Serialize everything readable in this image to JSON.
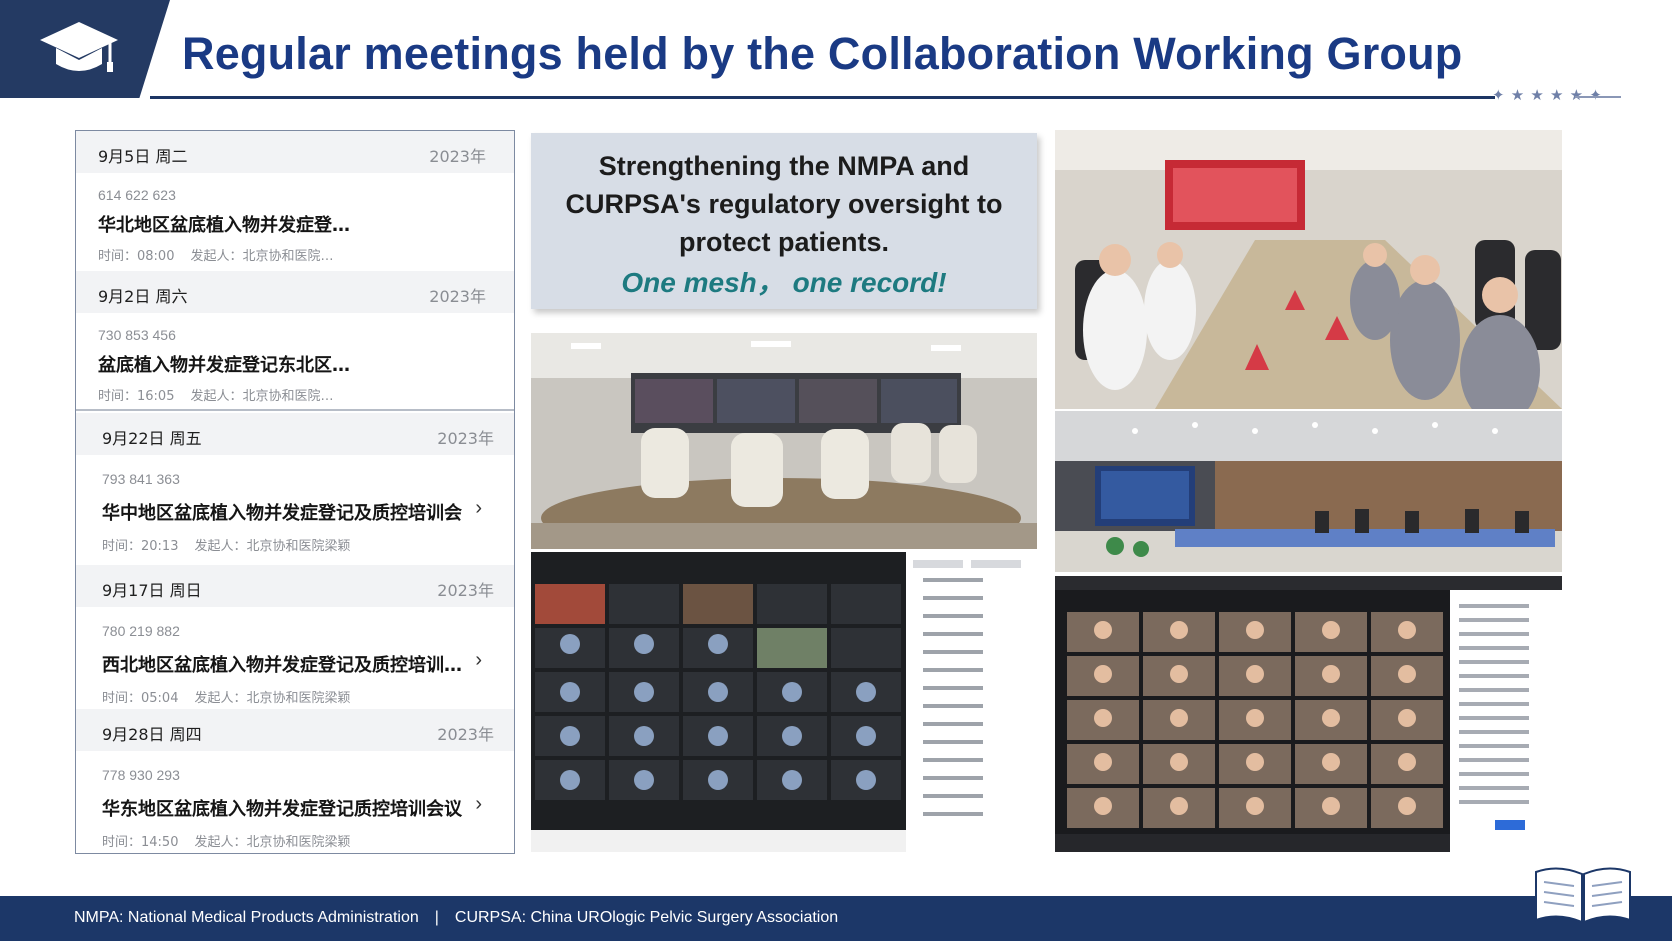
{
  "header": {
    "title": "Regular meetings held by the Collaboration Working Group"
  },
  "calendar": {
    "sections": [
      {
        "date": "9月5日 周二",
        "year": "2023年",
        "meeting_id": "614 622 623",
        "name": "华北地区盆底植入物并发症登…",
        "time": "时间：08:00",
        "organizer": "发起人：北京协和医院…",
        "has_arrow": false
      },
      {
        "date": "9月2日 周六",
        "year": "2023年",
        "meeting_id": "730 853 456",
        "name": "盆底植入物并发症登记东北区…",
        "time": "时间：16:05",
        "organizer": "发起人：北京协和医院…",
        "has_arrow": false
      },
      {
        "date": "9月22日 周五",
        "year": "2023年",
        "meeting_id": "793 841 363",
        "name": "华中地区盆底植入物并发症登记及质控培训会",
        "time": "时间：20:13",
        "organizer": "发起人：北京协和医院梁颖",
        "has_arrow": true
      },
      {
        "date": "9月17日 周日",
        "year": "2023年",
        "meeting_id": "780 219 882",
        "name": "西北地区盆底植入物并发症登记及质控培训…",
        "time": "时间：05:04",
        "organizer": "发起人：北京协和医院梁颖",
        "has_arrow": true
      },
      {
        "date": "9月28日 周四",
        "year": "2023年",
        "meeting_id": "778 930 293",
        "name": "华东地区盆底植入物并发症登记质控培训会议",
        "time": "时间：14:50",
        "organizer": "发起人：北京协和医院梁颖",
        "has_arrow": true
      }
    ]
  },
  "quote": {
    "main": "Strengthening the NMPA and CURPSA's regulatory oversight to protect patients.",
    "line1": "Strengthening the NMPA and",
    "line2": "CURPSA's regulatory oversight to",
    "line3": "protect patients.",
    "sub": "One mesh，  one record!"
  },
  "footer": {
    "nmpa": "NMPA: National Medical Products Administration",
    "separator": "|",
    "curpsa": "CURPSA: China UROlogic Pelvic Surgery Association"
  },
  "icons": {
    "header_icon": "graduation-cap-icon",
    "footer_icon": "open-book-icon"
  },
  "colors": {
    "navy": "#1c3768",
    "title_blue": "#1a3a84",
    "teal": "#1d7a80"
  }
}
